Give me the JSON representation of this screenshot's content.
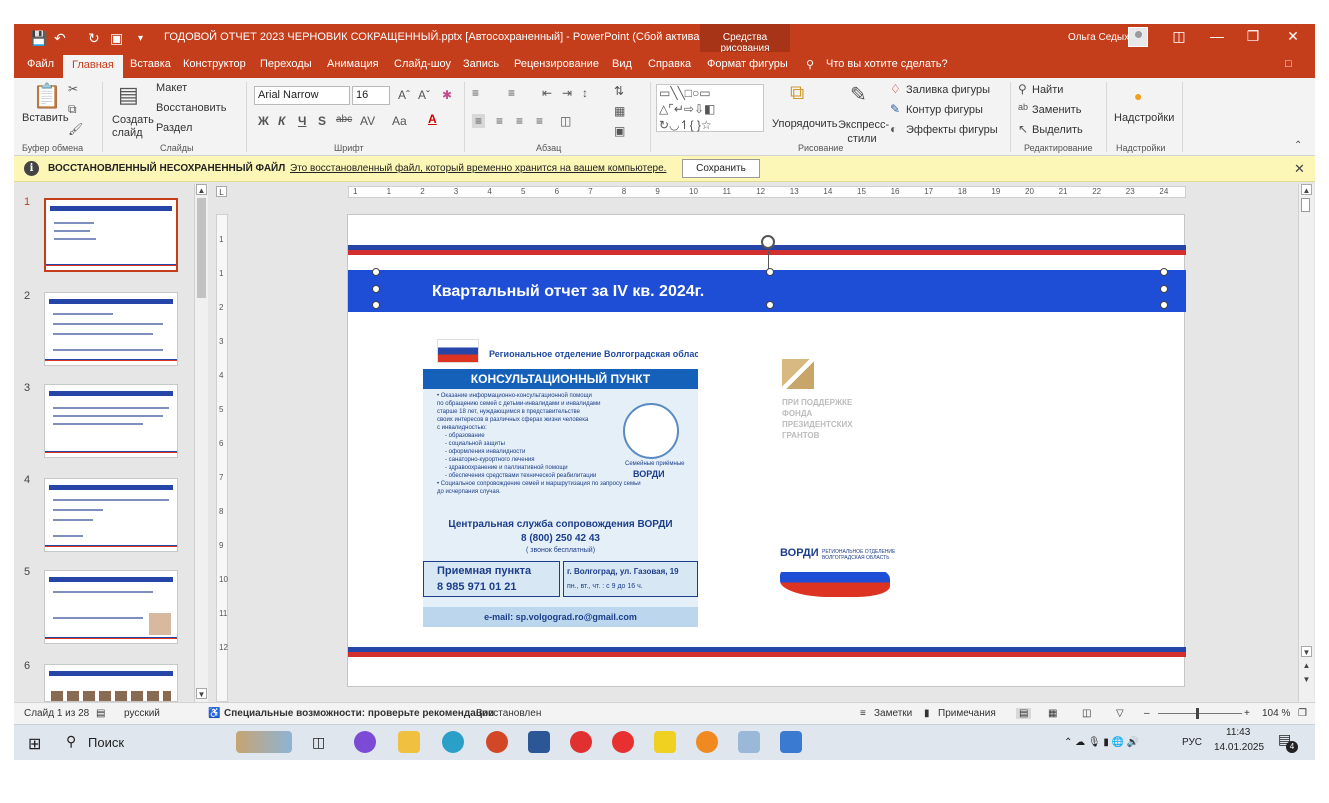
{
  "window": {
    "title": "ГОДОВОЙ ОТЧЕТ 2023 ЧЕРНОВИК СОКРАЩЕННЫЙ.pptx [Автосохраненный]  -  PowerPoint (Сбой активации...",
    "context_tab": "Средства рисования",
    "user": "Ольга Седых"
  },
  "tabs": [
    "Файл",
    "Главная",
    "Вставка",
    "Конструктор",
    "Переходы",
    "Анимация",
    "Слайд-шоу",
    "Запись",
    "Рецензирование",
    "Вид",
    "Справка",
    "Формат фигуры"
  ],
  "tell_me": "Что вы хотите сделать?",
  "ribbon": {
    "clipboard": {
      "paste": "Вставить",
      "group": "Буфер обмена"
    },
    "slides": {
      "new_slide": "Создать слайд",
      "layout": "Макет",
      "reset": "Восстановить",
      "section": "Раздел",
      "group": "Слайды"
    },
    "font": {
      "name": "Arial Narrow",
      "size": "16",
      "group": "Шрифт"
    },
    "paragraph": {
      "group": "Абзац"
    },
    "drawing": {
      "arrange": "Упорядочить",
      "quick_styles": "Экспресс-стили",
      "fill": "Заливка фигуры",
      "outline": "Контур фигуры",
      "effects": "Эффекты фигуры",
      "group": "Рисование"
    },
    "editing": {
      "find": "Найти",
      "replace": "Заменить",
      "select": "Выделить",
      "group": "Редактирование"
    },
    "addins": {
      "label": "Надстройки",
      "group": "Надстройки"
    }
  },
  "notification": {
    "title": "ВОССТАНОВЛЕННЫЙ НЕСОХРАНЕННЫЙ ФАЙЛ",
    "message": "Это восстановленный файл, который временно хранится на вашем компьютере.",
    "button": "Сохранить"
  },
  "thumbnails": [
    "1",
    "2",
    "3",
    "4",
    "5",
    "6"
  ],
  "ruler": {
    "h": [
      "1",
      "1",
      "2",
      "3",
      "4",
      "5",
      "6",
      "7",
      "8",
      "9",
      "10",
      "11",
      "12",
      "13",
      "14",
      "15",
      "16",
      "17",
      "18",
      "19",
      "20",
      "21",
      "22",
      "23",
      "24"
    ],
    "v": [
      "1",
      "1",
      "2",
      "3",
      "4",
      "5",
      "6",
      "7",
      "8",
      "9",
      "10",
      "11",
      "12"
    ]
  },
  "slide": {
    "title": "Квартальный отчет за IV кв. 2024г.",
    "poster": {
      "region": "Региональное отделение Волгоградская область",
      "heading": "КОНСУЛЬТАЦИОННЫЙ ПУНКТ",
      "lines": [
        "• Оказание информационно-консультационной помощи",
        "по обращению семей с детьми-инвалидами и инвалидами",
        "старше 18 лет, нуждающимся в представительстве",
        "своих интересов в различных сферах жизни человека",
        "с инвалидностью:",
        "- образование",
        "- социальной защиты",
        "- оформления инвалидности",
        "- санаторно-курортного лечения",
        "- здравоохранение и паллиативной помощи",
        "- обеспечения средствами технической реабилитации",
        "• Социальное сопровождение семей и маршрутизация по запросу семьи",
        "до исчерпания случая."
      ],
      "logo_caption": "Семейные приёмные",
      "logo_name": "ВОРДИ",
      "central": "Центральная служба сопровождения ВОРДИ",
      "central_phone": "8 (800) 250 42 43",
      "free_call": "( звонок бесплатный)",
      "reception": "Приемная пункта",
      "reception_phone": "8 985 971 01 21",
      "address": "г. Волгоград, ул. Газовая, 19",
      "hours": "пн., вт., чт. : с 9 до 16 ч.",
      "email": "e-mail: sp.volgograd.ro@gmail.com"
    },
    "grant_text": [
      "ПРИ ПОДДЕРЖКЕ",
      "ФОНДА",
      "ПРЕЗИДЕНТСКИХ",
      "ГРАНТОВ"
    ],
    "vordi_logo": "ВОРДИ",
    "vordi_small": [
      "РЕГИОНАЛЬНОЕ ОТДЕЛЕНИЕ",
      "ВОЛГОГРАДСКАЯ ОБЛАСТЬ"
    ]
  },
  "status": {
    "slide": "Слайд 1 из 28",
    "lang": "русский",
    "accessibility": "Специальные возможности: проверьте рекомендации",
    "state": "Восстановлен",
    "notes": "Заметки",
    "comments": "Примечания",
    "zoom": "104 %"
  },
  "taskbar": {
    "search": "Поиск",
    "lang": "РУС",
    "time": "11:43",
    "date": "14.01.2025",
    "notifications": "4"
  }
}
